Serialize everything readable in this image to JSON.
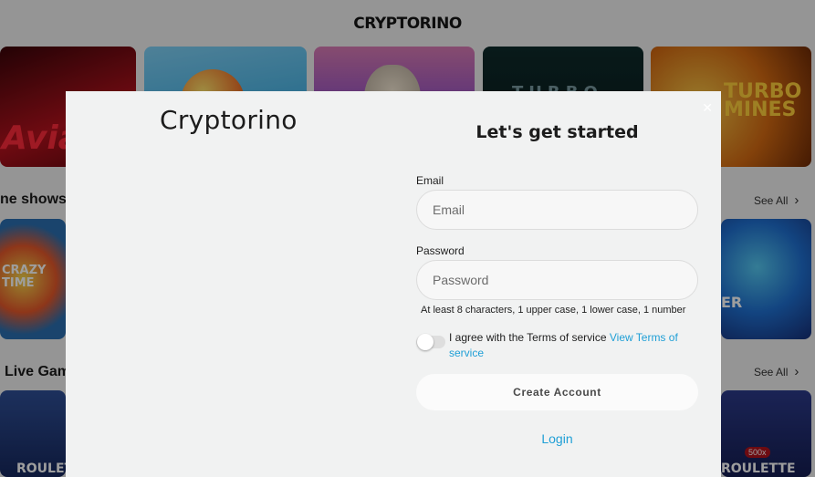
{
  "background": {
    "brand": "CRYPTORINO",
    "tiles_row1": [
      {
        "text": "Avia",
        "icon": "aviator-plane-icon"
      },
      {
        "text": "",
        "icon": "balloon-icon"
      },
      {
        "text": "",
        "icon": "zeus-icon"
      },
      {
        "text": "TURBO",
        "icon": "turbo-icon"
      },
      {
        "text": "TURBO MINES",
        "icon": "mines-icon"
      }
    ],
    "sections": [
      {
        "title": "ne shows",
        "see_all": "See All"
      },
      {
        "title": "Live Gam",
        "see_all": "See All"
      }
    ],
    "tiles_row2": [
      {
        "text": "CRAZY TIME"
      },
      {
        "text": "ER"
      }
    ],
    "tiles_row3": [
      {
        "text": "ROULET"
      },
      {
        "text": "ROULETTE"
      }
    ],
    "badge": "500x"
  },
  "modal": {
    "logo": "Cryptorino",
    "title": "Let's get started",
    "email_label": "Email",
    "email_placeholder": "Email",
    "email_value": "",
    "password_label": "Password",
    "password_placeholder": "Password",
    "password_value": "",
    "password_hint": "At least 8 characters, 1 upper case, 1 lower case, 1 number",
    "agree_text": "I agree with the Terms of service ",
    "terms_link": "View Terms of service",
    "terms_checked": false,
    "create_button": "Create Account",
    "login_link": "Login",
    "close_icon": "close-icon"
  },
  "colors": {
    "accent": "#1f9fd6",
    "modal_bg": "#f1f2f2"
  }
}
